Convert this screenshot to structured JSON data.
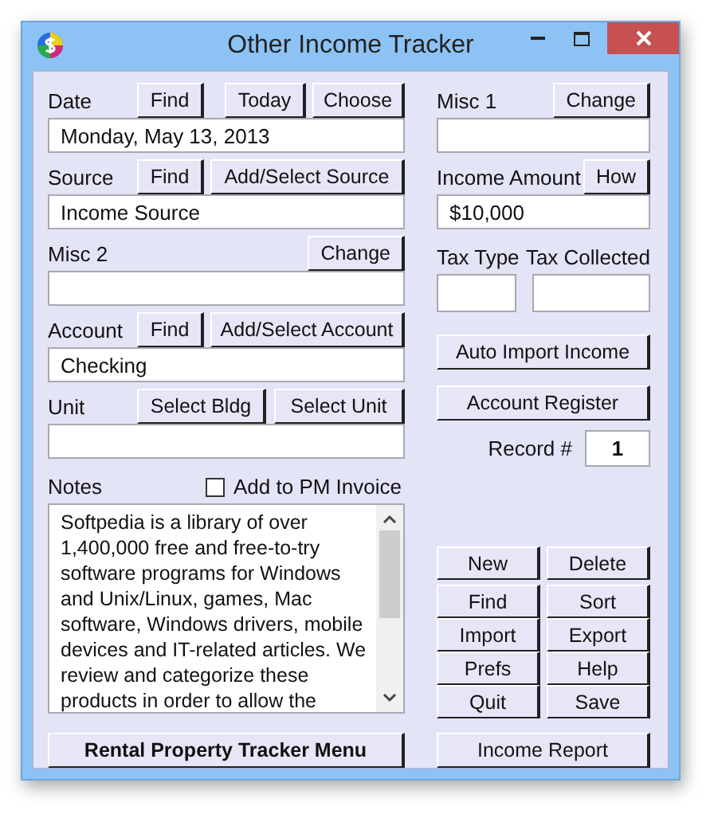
{
  "window": {
    "title": "Other Income Tracker"
  },
  "left_fields": [
    {
      "label": "Date",
      "buttons": [
        "Find",
        "Today",
        "Choose"
      ],
      "value": "Monday, May 13, 2013"
    },
    {
      "label": "Source",
      "buttons": [
        "Find",
        "Add/Select Source"
      ],
      "value": "Income Source"
    },
    {
      "label": "Misc 2",
      "buttons": [
        "Change"
      ]
    },
    {
      "label": "Account",
      "buttons": [
        "Find",
        "Add/Select Account"
      ],
      "value": "Checking"
    },
    {
      "label": "Unit",
      "buttons": [
        "Select Bldg",
        "Select Unit"
      ]
    }
  ],
  "notes": {
    "label": "Notes",
    "add_to_pm_invoice": {
      "label": "Add to PM Invoice",
      "checked": false
    },
    "text": "Softpedia is a library of over\n1,400,000 free and free-to-try\nsoftware programs for Windows\nand Unix/Linux, games, Mac\nsoftware, Windows drivers, mobile\ndevices and IT-related articles. We\nreview and categorize these\nproducts in order to allow the"
  },
  "menu_button": "Rental Property Tracker Menu",
  "right_fields": [
    {
      "label": "Misc 1",
      "buttons": [
        "Change"
      ]
    },
    {
      "label": "Income Amount",
      "buttons": [
        "How"
      ],
      "value": "$10,000"
    }
  ],
  "tax_fields": [
    {
      "label": "Tax Type"
    },
    {
      "label": "Tax Collected"
    }
  ],
  "actions": [
    "Auto Import Income",
    "Account Register"
  ],
  "record": {
    "label": "Record #",
    "value": "1"
  },
  "command_buttons": [
    "New",
    "Delete",
    "Find",
    "Sort",
    "Import",
    "Export",
    "Prefs",
    "Help",
    "Quit",
    "Save"
  ],
  "report_button": "Income Report"
}
